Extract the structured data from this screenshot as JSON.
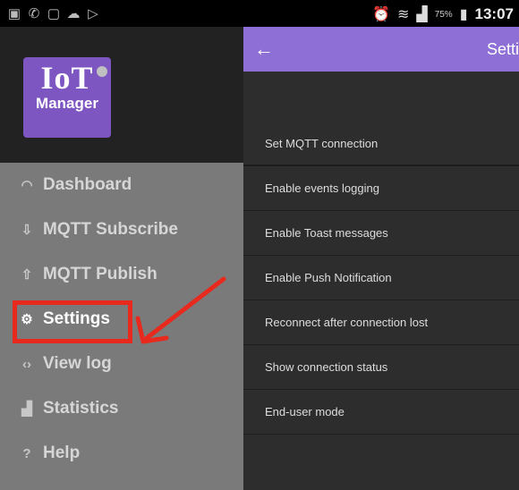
{
  "status_bar": {
    "icons": [
      "sim-icon",
      "call-icon",
      "image-icon",
      "cloud-upload-icon",
      "play-icon"
    ],
    "right_icons": [
      "alarm-icon",
      "wifi-icon",
      "signal-icon"
    ],
    "battery": "75%",
    "time": "13:07"
  },
  "drawer": {
    "logo_title": "IoT",
    "logo_subtitle": "Manager",
    "items": [
      {
        "label": "Dashboard",
        "icon": "dashboard-icon"
      },
      {
        "label": "MQTT Subscribe",
        "icon": "subscribe-icon"
      },
      {
        "label": "MQTT Publish",
        "icon": "publish-icon"
      },
      {
        "label": "Settings",
        "icon": "settings-icon"
      },
      {
        "label": "View log",
        "icon": "code-icon"
      },
      {
        "label": "Statistics",
        "icon": "chart-icon"
      },
      {
        "label": "Help",
        "icon": "help-icon"
      }
    ]
  },
  "toolbar": {
    "title": "Settin"
  },
  "settings": [
    "Set MQTT connection",
    "Enable events logging",
    "Enable Toast messages",
    "Enable Push Notification",
    "Reconnect after connection lost",
    "Show connection status",
    "End-user mode"
  ],
  "colors": {
    "accent": "#8d6fd6",
    "logo": "#7e56c2",
    "annotation": "#e82a1e"
  }
}
